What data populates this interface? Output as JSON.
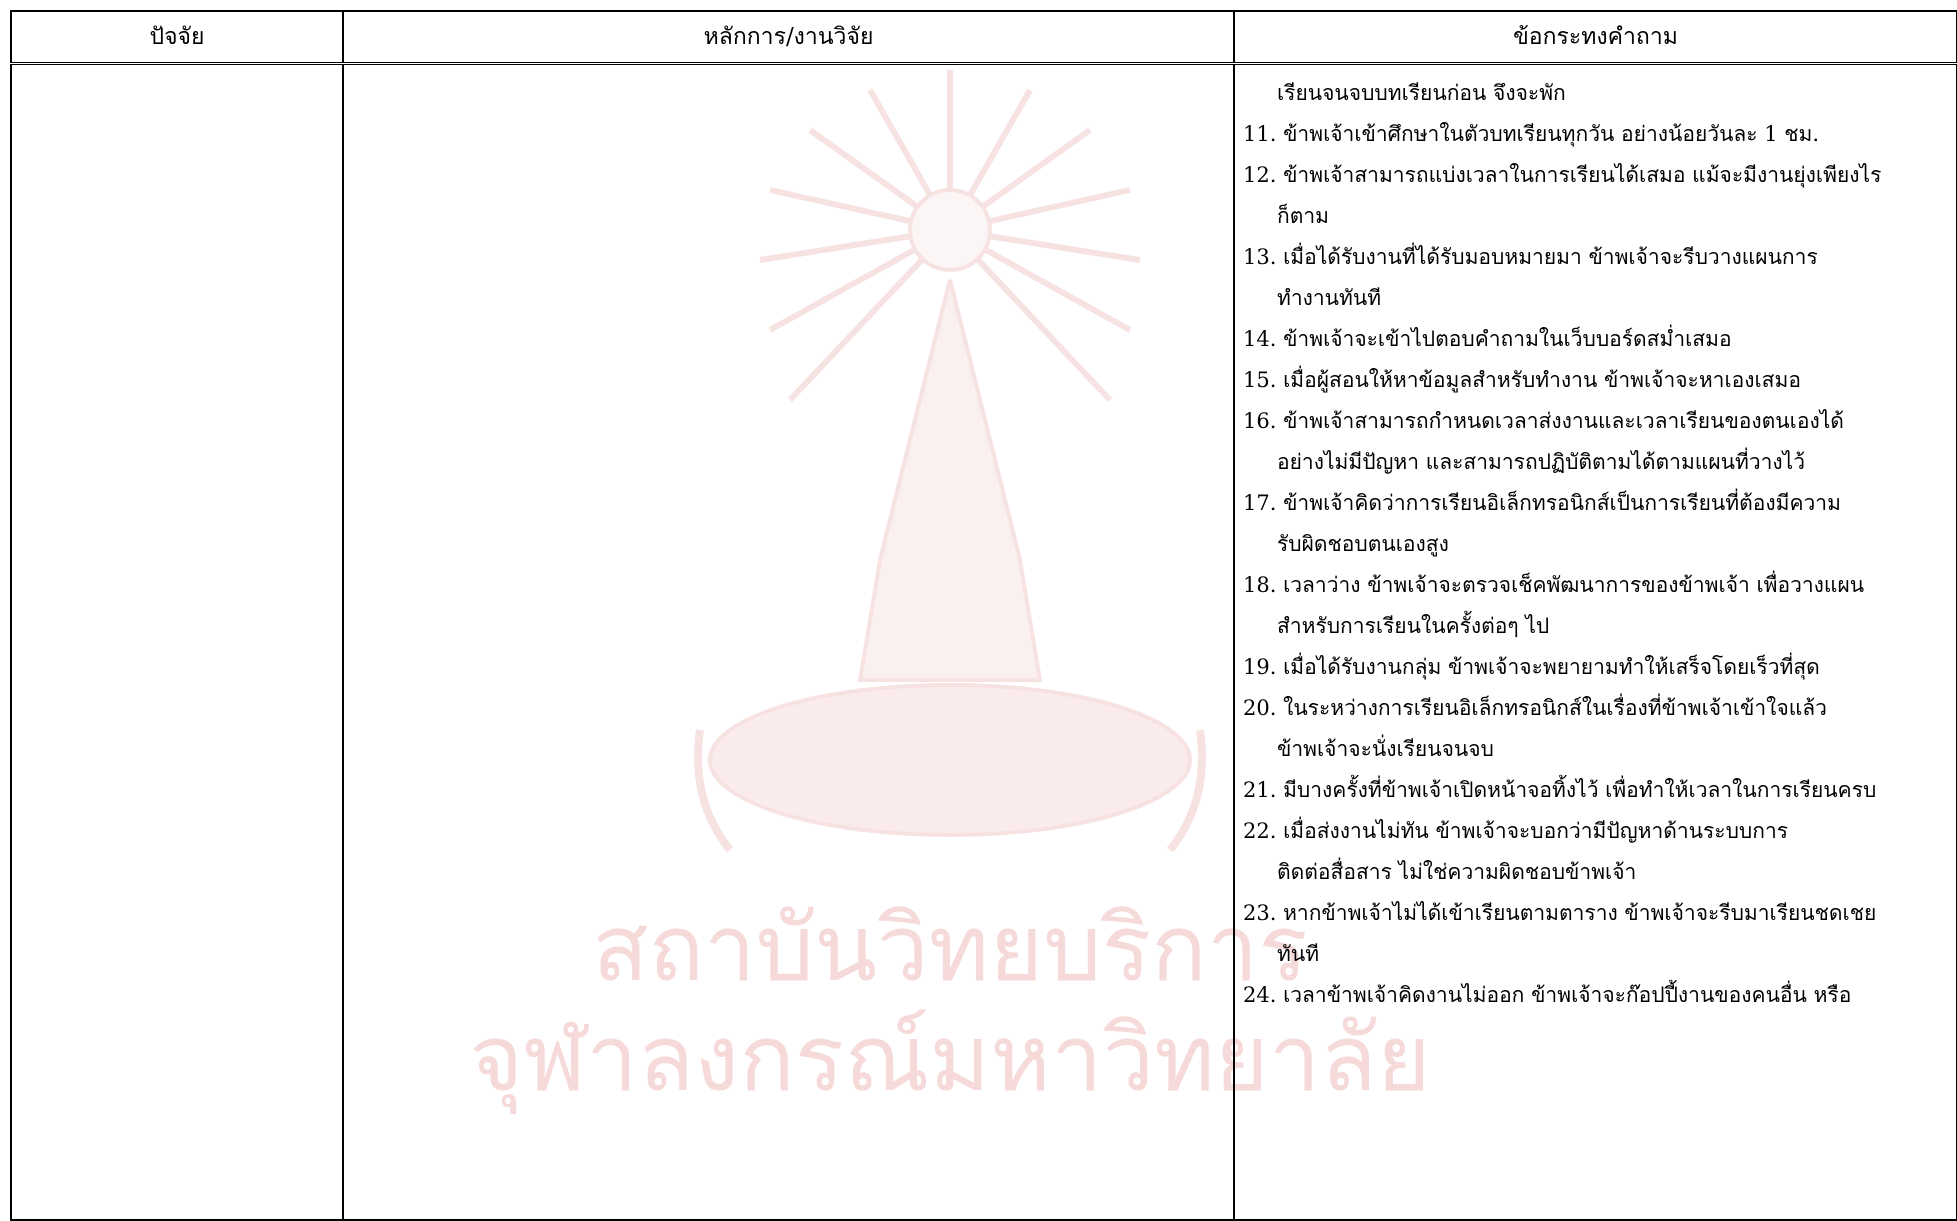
{
  "table": {
    "headers": [
      "ปัจจัย",
      "หลักการ/งานวิจัย",
      "ข้อกระทงคำถาม"
    ],
    "question_lines": [
      "เรียนจนจบบทเรียนก่อน จึงจะพัก",
      "11. ข้าพเจ้าเข้าศึกษาในตัวบทเรียนทุกวัน อย่างน้อยวันละ 1 ชม.",
      "12. ข้าพเจ้าสามารถแบ่งเวลาในการเรียนได้เสมอ แม้จะมีงานยุ่งเพียงไร",
      "ก็ตาม",
      "13. เมื่อได้รับงานที่ได้รับมอบหมายมา ข้าพเจ้าจะรีบวางแผนการ",
      "ทำงานทันที",
      "14. ข้าพเจ้าจะเข้าไปตอบคำถามในเว็บบอร์ดสม่ำเสมอ",
      "15. เมื่อผู้สอนให้หาข้อมูลสำหรับทำงาน ข้าพเจ้าจะหาเองเสมอ",
      "16. ข้าพเจ้าสามารถกำหนดเวลาส่งงานและเวลาเรียนของตนเองได้",
      "อย่างไม่มีปัญหา และสามารถปฏิบัติตามได้ตามแผนที่วางไว้",
      "17. ข้าพเจ้าคิดว่าการเรียนอิเล็กทรอนิกส์เป็นการเรียนที่ต้องมีความ",
      "รับผิดชอบตนเองสูง",
      "18. เวลาว่าง ข้าพเจ้าจะตรวจเช็คพัฒนาการของข้าพเจ้า เพื่อวางแผน",
      "สำหรับการเรียนในครั้งต่อๆ ไป",
      "19. เมื่อได้รับงานกลุ่ม ข้าพเจ้าจะพยายามทำให้เสร็จโดยเร็วที่สุด",
      "20. ในระหว่างการเรียนอิเล็กทรอนิกส์ในเรื่องที่ข้าพเจ้าเข้าใจแล้ว",
      "ข้าพเจ้าจะนั่งเรียนจนจบ",
      "21. มีบางครั้งที่ข้าพเจ้าเปิดหน้าจอทิ้งไว้ เพื่อทำให้เวลาในการเรียนครบ",
      "22. เมื่อส่งงานไม่ทัน ข้าพเจ้าจะบอกว่ามีปัญหาด้านระบบการ",
      "ติดต่อสื่อสาร ไม่ใช่ความผิดชอบข้าพเจ้า",
      "23. หากข้าพเจ้าไม่ได้เข้าเรียนตามตาราง ข้าพเจ้าจะรีบมาเรียนชดเชย",
      "ทันที",
      "24. เวลาข้าพเจ้าคิดงานไม่ออก ข้าพเจ้าจะก๊อปปี้งานของคนอื่น หรือ"
    ],
    "indented_lines": [
      0,
      3,
      5,
      9,
      11,
      13,
      16,
      19,
      21
    ]
  },
  "watermark": {
    "line1": "สถาบันวิทยบริการ",
    "line2": "จุฬาลงกรณ์มหาวิทยาลัย",
    "color": "#f6d9d9"
  }
}
